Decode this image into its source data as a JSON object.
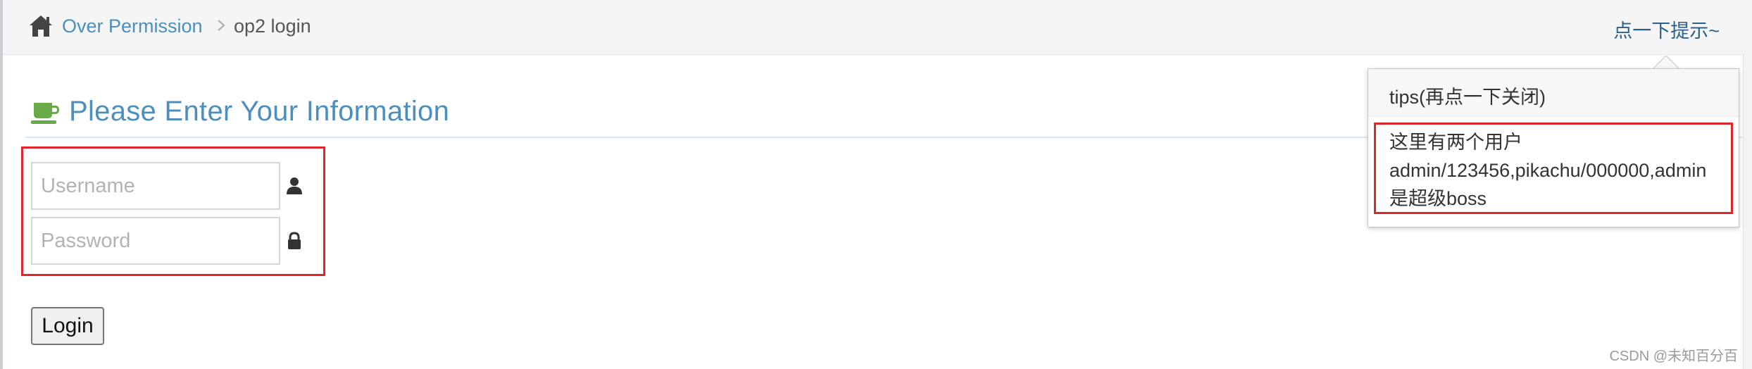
{
  "breadcrumb": {
    "section": "Over Permission",
    "current": "op2 login"
  },
  "header": {
    "tip_link": "点一下提示~"
  },
  "form": {
    "heading": "Please Enter Your Information",
    "username_placeholder": "Username",
    "password_placeholder": "Password",
    "login_label": "Login"
  },
  "popover": {
    "title": "tips(再点一下关闭)",
    "lines": [
      "这里有两个用户",
      "admin/123456,pikachu/000000,admin",
      "是超级boss"
    ]
  },
  "watermark": "CSDN @未知百分百",
  "icons": {
    "home": "home-icon",
    "breadcrumb_separator": "chevron-right-icon",
    "heading": "coffee-cup-icon",
    "username": "user-icon",
    "password": "lock-icon"
  },
  "colors": {
    "link": "#4c8fbd",
    "heading": "#4c8fbd",
    "highlight": "#e0262b",
    "heading_icon": "#69aa46"
  }
}
